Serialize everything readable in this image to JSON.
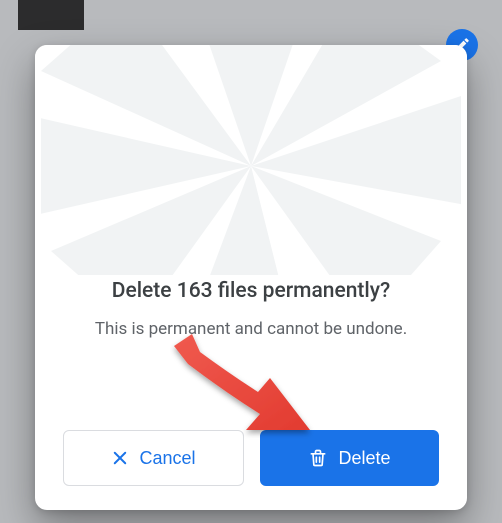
{
  "modal": {
    "title": "Delete 163 files permanently?",
    "subtitle": "This is permanent and cannot be undone.",
    "cancel_label": "Cancel",
    "delete_label": "Delete"
  },
  "colors": {
    "primary": "#1a73e8",
    "text_primary": "#3c4043",
    "text_secondary": "#5f6368",
    "border": "#dadce0",
    "arrow": "#e8453b"
  },
  "icons": {
    "close": "close-icon",
    "trash": "trash-icon",
    "pencil_badge": "pencil-icon"
  }
}
